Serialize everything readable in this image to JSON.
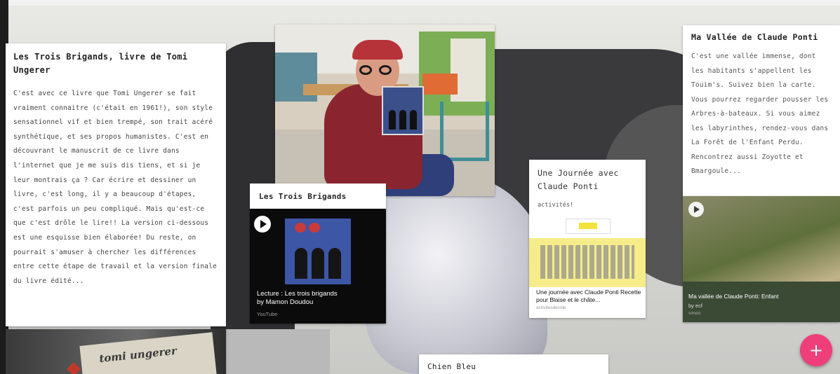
{
  "card_brigands_text": {
    "title": "Les Trois Brigands, livre de Tomi Ungerer",
    "body": "C'est avec ce livre que Tomi Ungerer se fait vraiment connaitre (c'était en 1961!), son style sensationnel vif et bien trempé, son trait acéré synthétique, et ses propos humanistes. C'est en découvrant le manuscrit de ce livre dans l'internet que je me suis dis tiens, et si je leur montrais ça ? Car écrire et dessiner un livre, c'est long, il y a beaucoup d'étapes, c'est parfois un peu compliqué. Mais qu'est-ce que c'est drôle le lire!! La version ci-dessous est une esquisse bien élaborée! Du reste, on pourrait s'amuser à chercher les différences entre cette étape de travail et la version finale du livre édité...",
    "image_text": "tomi ungerer"
  },
  "card_brigands_audio": {
    "title": "Les Trois Brigands",
    "track_title": "Lecture : Les trois brigands",
    "track_author": "by Mamon Doudou",
    "source": "YouTube"
  },
  "card_activity": {
    "title": "Une Journée avec Claude Ponti",
    "tag": "activités!",
    "link_title": "Une journée avec Claude Ponti Recette pour Blaise et le châte...",
    "link_domain": "activitesdecole"
  },
  "card_vallee": {
    "title": "Ma Vallée de Claude Ponti",
    "body": "C'est une vallée immense, dont les habitants s'appellent les Touim's. Suivez bien la carte. Vous pourrez regarder pousser les Arbres-à-bateaux. Si vous aimez les labyrinthes, rendez-vous dans La Forêt de l'Enfant Perdu. Rencontrez aussi Zoyotte et Bmargoule...",
    "media_title": "Ma vallée de Claude Ponti: Enfant",
    "media_author": "by ecf",
    "media_source": "vimeo"
  },
  "card_chien": {
    "title": "Chien Bleu"
  },
  "fab": {
    "label": "+"
  },
  "colors": {
    "fab": "#ee3f7a",
    "dark_card": "#0b0b0b"
  }
}
